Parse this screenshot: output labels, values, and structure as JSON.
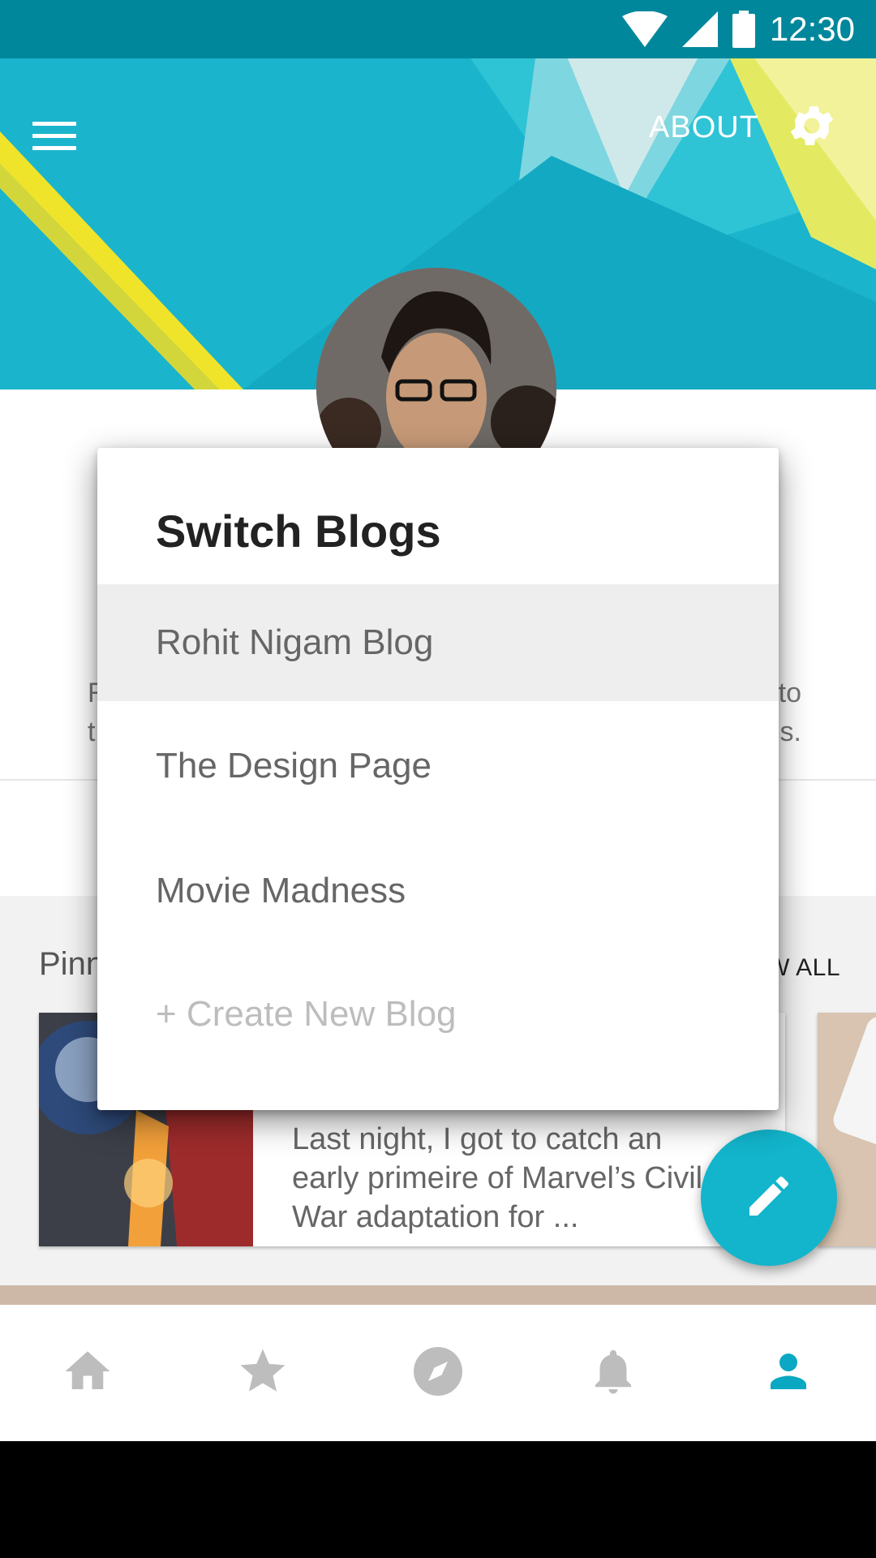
{
  "status_bar": {
    "time": "12:30"
  },
  "header": {
    "about_label": "ABOUT"
  },
  "profile": {
    "bio_line1_left": "R",
    "bio_line1_right": "to",
    "bio_line2_left": "t",
    "bio_line2_right": "s."
  },
  "pinned": {
    "title": "Pinn",
    "view_all": "W ALL",
    "card_excerpt": "Last night, I got to catch an early primeire of Marvel’s Civil War adaptation for ..."
  },
  "dialog": {
    "title": "Switch Blogs",
    "options": [
      {
        "label": "Rohit Nigam Blog",
        "selected": true
      },
      {
        "label": "The Design Page",
        "selected": false
      },
      {
        "label": "Movie Madness",
        "selected": false
      }
    ],
    "create_label": "+ Create New Blog"
  },
  "bottom_nav": {
    "items": [
      {
        "icon": "home-icon",
        "active": false
      },
      {
        "icon": "star-icon",
        "active": false
      },
      {
        "icon": "compass-icon",
        "active": false
      },
      {
        "icon": "bell-icon",
        "active": false
      },
      {
        "icon": "person-icon",
        "active": true
      }
    ]
  },
  "colors": {
    "status_bar": "#00879b",
    "accent": "#12b5cc",
    "nav_active": "#0aa8c2",
    "nav_inactive": "#bdbdbd"
  }
}
